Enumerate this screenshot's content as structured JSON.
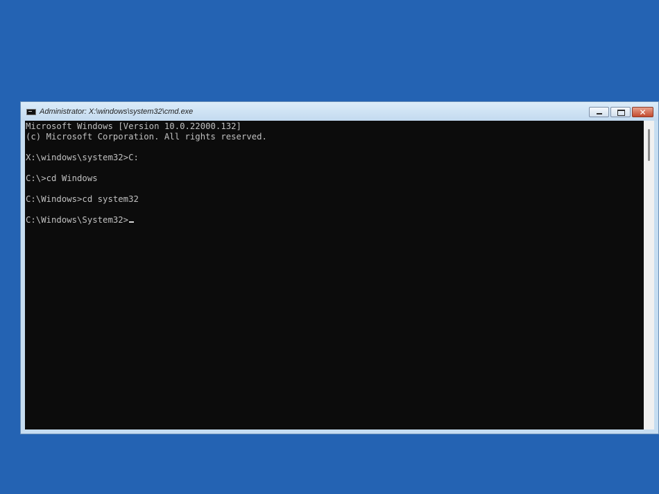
{
  "window": {
    "title": "Administrator: X:\\windows\\system32\\cmd.exe",
    "close_glyph": "✕"
  },
  "console": {
    "lines": [
      "Microsoft Windows [Version 10.0.22000.132]",
      "(c) Microsoft Corporation. All rights reserved.",
      "",
      "X:\\windows\\system32>C:",
      "",
      "C:\\>cd Windows",
      "",
      "C:\\Windows>cd system32",
      "",
      "C:\\Windows\\System32>"
    ]
  },
  "colors": {
    "desktop": "#2463b3",
    "console_background": "#0c0c0c",
    "console_text": "#c0c0c0",
    "close_button": "#c34b2f"
  },
  "icons": {
    "app": "cmd-icon",
    "minimize": "minimize-icon",
    "maximize": "restore-icon",
    "close": "close-icon"
  }
}
